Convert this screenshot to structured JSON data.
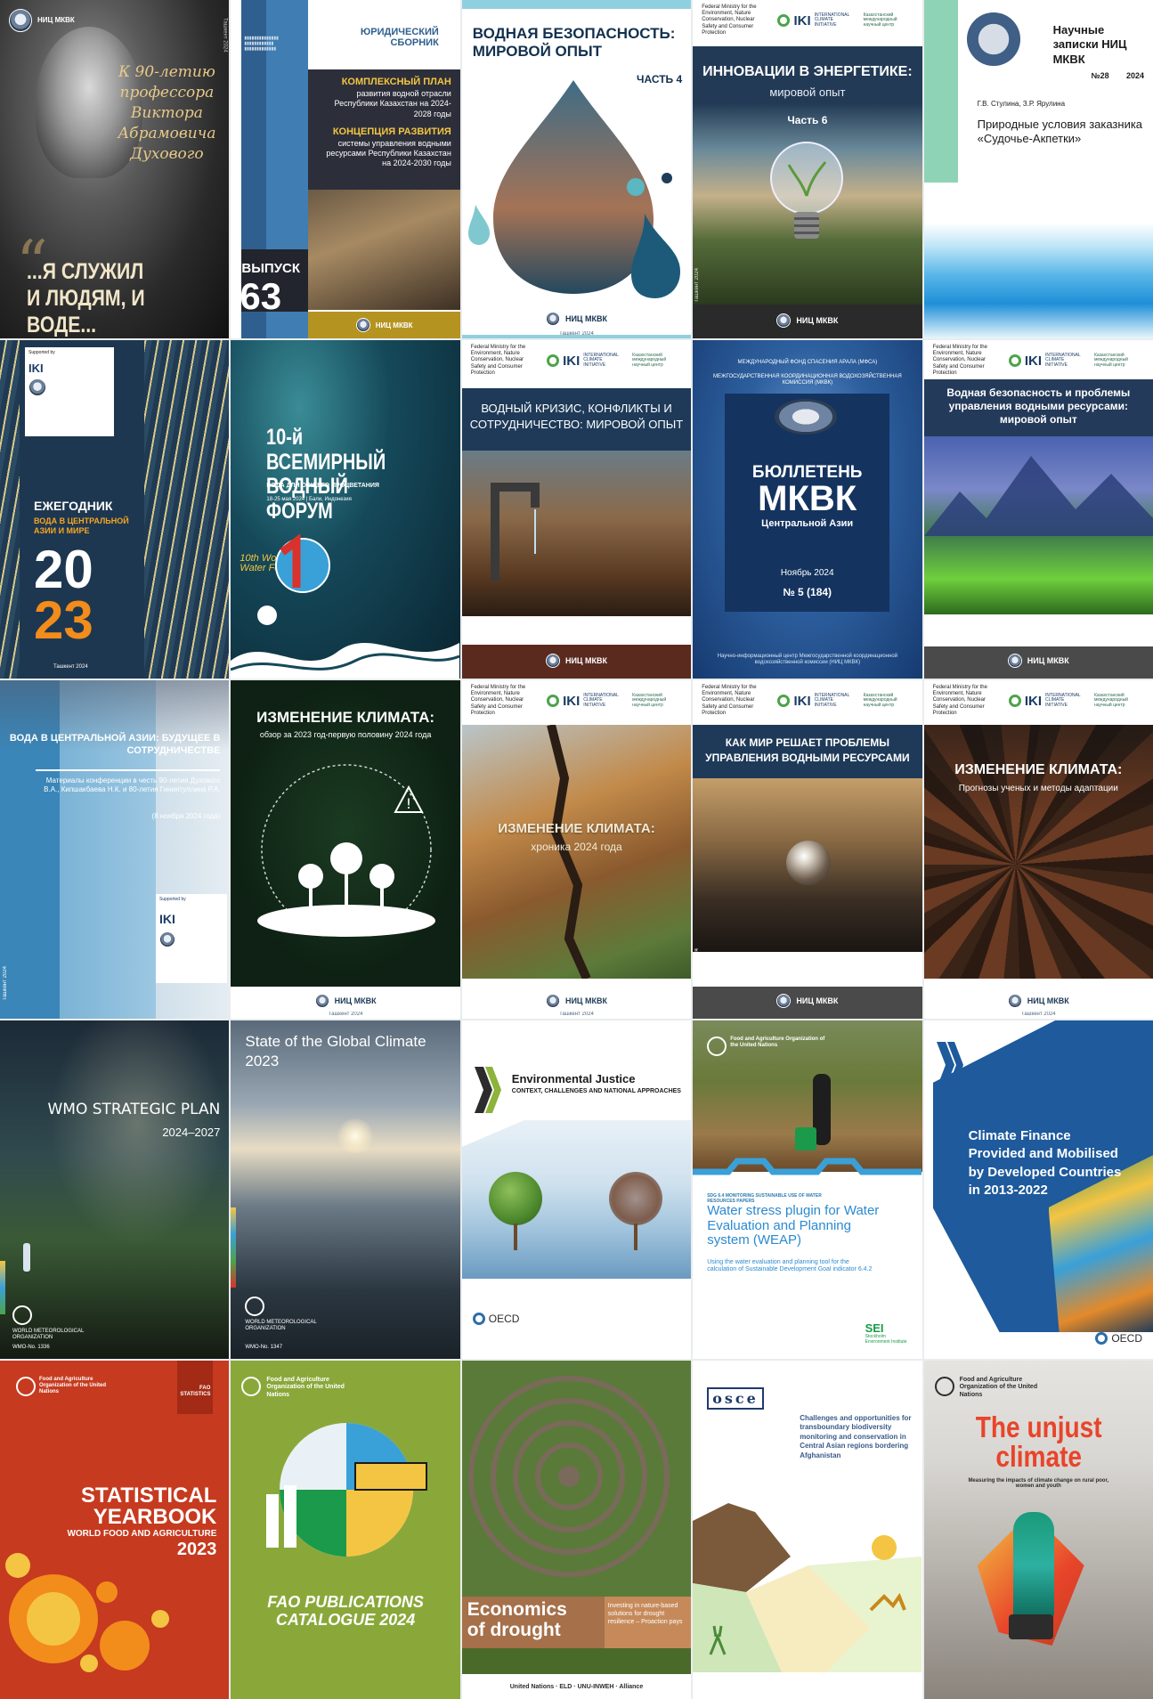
{
  "covers": [
    {
      "id": "c1",
      "brand": "НИЦ МКВК",
      "script": "К 90-летию профессора Виктора Абрамовича Духового",
      "quote_line1": "...Я СЛУЖИЛ",
      "quote_line2": "И ЛЮДЯМ, И ВОДЕ...",
      "side": "Ташкент 2024"
    },
    {
      "id": "c2",
      "top_label": "ЮРИДИЧЕСКИЙ\nСБОРНИК",
      "plan_title": "КОМПЛЕКСНЫЙ ПЛАН",
      "plan_text": "развития водной отрасли Республики Казахстан на 2024-2028 годы",
      "concept_title": "КОНЦЕПЦИЯ РАЗВИТИЯ",
      "concept_text": "системы управления водными ресурсами Республики Казахстан на 2024-2030 годы",
      "issue_label": "ВЫПУСК",
      "issue_number": "63",
      "brand": "НИЦ МКВК"
    },
    {
      "id": "c3",
      "title": "ВОДНАЯ БЕЗОПАСНОСТЬ: МИРОВОЙ ОПЫТ",
      "part": "ЧАСТЬ 4",
      "brand": "НИЦ МКВК",
      "city": "Ташкент 2024"
    },
    {
      "id": "c4",
      "title": "ИННОВАЦИИ В ЭНЕРГЕТИКЕ:",
      "subtitle": "мировой опыт",
      "part": "Часть 6",
      "brand": "НИЦ МКВК",
      "side": "Ташкент 2024"
    },
    {
      "id": "c5",
      "title": "Научные записки НИЦ МКВК",
      "number": "№28",
      "year": "2024",
      "authors": "Г.В. Стулина, З.Р. Ярулина",
      "paper": "Природные условия заказника «Судочье-Акпетки»"
    },
    {
      "id": "c6",
      "label": "ЕЖЕГОДНИК",
      "subtitle": "ВОДА В ЦЕНТРАЛЬНОЙ АЗИИ И МИРЕ",
      "year_top": "20",
      "year_bottom": "23",
      "city": "Ташкент 2024"
    },
    {
      "id": "c7",
      "title": "10-й ВСЕМИРНЫЙ ВОДНЫЙ ФОРУМ",
      "subtitle": "ВОДА ДЛЯ ОБЩЕГО ПРОЦВЕТАНИЯ",
      "date": "18-25 мая 2024 | Бали, Индонезия",
      "logo_text": "10th World Water Forum"
    },
    {
      "id": "c8",
      "title": "ВОДНЫЙ КРИЗИС, КОНФЛИКТЫ И СОТРУДНИЧЕСТВО: МИРОВОЙ ОПЫТ",
      "brand": "НИЦ МКВК"
    },
    {
      "id": "c9",
      "header1": "МЕЖДУНАРОДНЫЙ ФОНД СПАСЕНИЯ АРАЛА (МФСА)",
      "header2": "МЕЖГОСУДАРСТВЕННАЯ КООРДИНАЦИОННАЯ ВОДОХОЗЯЙСТВЕННАЯ КОМИССИЯ (МКВК)",
      "title1": "БЮЛЛЕТЕНЬ",
      "title2": "МКВК",
      "title3": "Центральной Азии",
      "date": "Ноябрь 2024",
      "issue": "№ 5 (184)",
      "footer": "Научно-информационный центр Межгосударственной координационной водохозяйственной комиссии (НИЦ МКВК)"
    },
    {
      "id": "c10",
      "title": "Водная безопасность и проблемы управления водными ресурсами: мировой опыт",
      "brand": "НИЦ МКВК"
    },
    {
      "id": "c11",
      "title": "ВОДА В ЦЕНТРАЛЬНОЙ АЗИИ: БУДУЩЕЕ В СОТРУДНИЧЕСТВЕ",
      "text": "Материалы конференции в честь 90-летия Духового В.А., Кипшакбаева Н.К. и 80-летия Гиниятуллина Р.А.",
      "date": "(8 ноября 2024 года)",
      "side": "Ташкент 2024"
    },
    {
      "id": "c12",
      "title": "ИЗМЕНЕНИЕ КЛИМАТА:",
      "subtitle": "обзор за 2023 год-первую половину 2024 года",
      "brand": "НИЦ МКВК",
      "city": "Ташкент 2024"
    },
    {
      "id": "c13",
      "title": "ИЗМЕНЕНИЕ КЛИМАТА:",
      "subtitle": "хроника 2024 года",
      "brand": "НИЦ МКВК",
      "city": "Ташкент 2024"
    },
    {
      "id": "c14",
      "title": "КАК МИР РЕШАЕТ ПРОБЛЕМЫ УПРАВЛЕНИЯ ВОДНЫМИ РЕСУРСАМИ",
      "brand": "НИЦ МКВК",
      "side": "Ташкент 2024"
    },
    {
      "id": "c15",
      "title": "ИЗМЕНЕНИЕ КЛИМАТА:",
      "subtitle": "Прогнозы ученых и методы адаптации",
      "brand": "НИЦ МКВК",
      "city": "Ташкент 2024"
    },
    {
      "id": "c16",
      "title": "WMO STRATEGIC PLAN",
      "years": "2024–2027",
      "org": "WORLD METEOROLOGICAL ORGANIZATION",
      "code": "WMO-No. 1336"
    },
    {
      "id": "c17",
      "title": "State of the Global Climate",
      "year": "2023",
      "org": "WORLD METEOROLOGICAL ORGANIZATION",
      "code": "WMO-No. 1347"
    },
    {
      "id": "c18",
      "title": "Environmental Justice",
      "subtitle": "CONTEXT, CHALLENGES AND NATIONAL APPROACHES",
      "brand": "OECD"
    },
    {
      "id": "c19",
      "org": "Food and Agriculture Organization of the United Nations",
      "series": "SDG 6.4 MONITORING SUSTAINABLE USE OF WATER RESOURCES PAPERS",
      "title": "Water stress plugin for Water Evaluation and Planning system (WEAP)",
      "subtitle": "Using the water evaluation and planning tool for the calculation of Sustainable Development Goal indicator 6.4.2",
      "sei": "SEI",
      "sei_name": "Stockholm Environment Institute"
    },
    {
      "id": "c20",
      "title": "Climate Finance Provided and Mobilised by Developed Countries in 2013-2022",
      "brand": "OECD"
    },
    {
      "id": "c21",
      "org": "Food and Agriculture Organization of the United Nations",
      "tag": "FAO STATISTICS",
      "title1": "STATISTICAL",
      "title2": "YEARBOOK",
      "subtitle": "WORLD FOOD AND AGRICULTURE",
      "year": "2023"
    },
    {
      "id": "c22",
      "org": "Food and Agriculture Organization of the United Nations",
      "title1": "FAO PUBLICATIONS",
      "title2": "CATALOGUE 2024"
    },
    {
      "id": "c23",
      "title1": "Economics",
      "title2": "of drought",
      "subtitle": "Investing in nature-based solutions for drought resilience – Proaction pays",
      "logos": "United Nations · ELD · UNU-INWEH · Alliance"
    },
    {
      "id": "c24",
      "brand": "osce",
      "title": "Challenges and opportunities for transboundary biodiversity monitoring and conservation in Central Asian regions bordering Afghanistan"
    },
    {
      "id": "c25",
      "org": "Food and Agriculture Organization of the United Nations",
      "title1": "The unjust",
      "title2": "climate",
      "subtitle": "Measuring the impacts of climate change on rural poor, women and youth"
    }
  ]
}
